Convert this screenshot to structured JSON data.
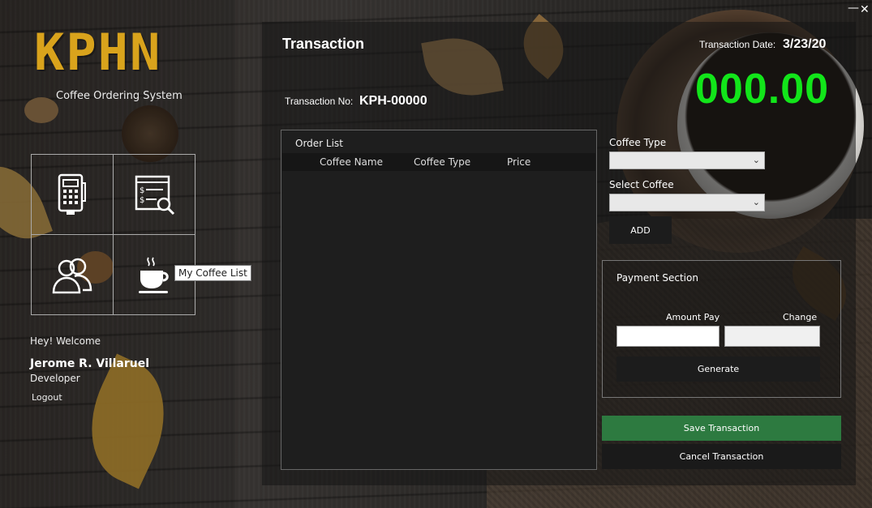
{
  "window": {
    "minimize_glyph": "—",
    "close_glyph": "✕"
  },
  "brand": {
    "logo": "KPHN",
    "subtitle": "Coffee Ordering System",
    "logo_color": "#d9a31c"
  },
  "sidebar": {
    "tiles": [
      {
        "icon": "pos-terminal-icon"
      },
      {
        "icon": "invoice-search-icon"
      },
      {
        "icon": "users-icon"
      },
      {
        "icon": "coffee-cup-icon"
      }
    ],
    "tooltip": "My Coffee List",
    "welcome": "Hey! Welcome",
    "user_name": "Jerome R. Villaruel",
    "user_role": "Developer",
    "logout": "Logout"
  },
  "transaction": {
    "title": "Transaction",
    "date_label": "Transaction Date:",
    "date": "3/23/20",
    "total": "000.00",
    "total_color": "#12e51a",
    "number_label": "Transaction No:",
    "number": "KPH-00000"
  },
  "order_list": {
    "title": "Order List",
    "columns": [
      "Coffee Name",
      "Coffee Type",
      "Price"
    ],
    "rows": []
  },
  "form": {
    "coffee_type_label": "Coffee Type",
    "coffee_type_value": "",
    "select_coffee_label": "Select Coffee",
    "select_coffee_value": "",
    "add_label": "ADD"
  },
  "payment": {
    "title": "Payment Section",
    "amount_label": "Amount Pay",
    "amount_value": "",
    "change_label": "Change",
    "change_value": "",
    "generate_label": "Generate"
  },
  "actions": {
    "save_label": "Save Transaction",
    "save_color": "#2d7a40",
    "cancel_label": "Cancel Transaction"
  }
}
